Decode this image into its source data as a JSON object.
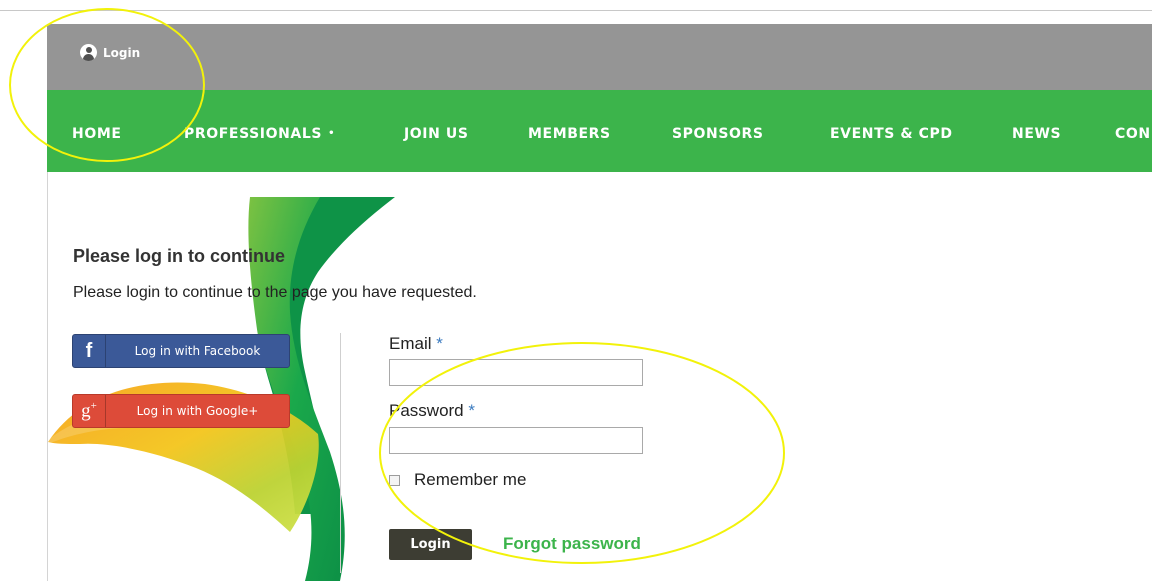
{
  "utility_bar": {
    "login_label": "Login",
    "icon": "user-icon"
  },
  "nav": {
    "items": [
      {
        "label": "HOME"
      },
      {
        "label": "PROFESSIONALS",
        "caret": "•"
      },
      {
        "label": "JOIN US"
      },
      {
        "label": "MEMBERS"
      },
      {
        "label": "SPONSORS"
      },
      {
        "label": "EVENTS & CPD"
      },
      {
        "label": "NEWS"
      },
      {
        "label": "CON"
      }
    ]
  },
  "page": {
    "title": "Please log in to continue",
    "subtitle": "Please login to continue to the page you have requested."
  },
  "social": {
    "facebook": {
      "icon_glyph": "f",
      "label": "Log in with Facebook"
    },
    "google": {
      "icon_glyph": "g",
      "icon_sup": "+",
      "label": "Log in with Google+"
    }
  },
  "form": {
    "email_label": "Email",
    "password_label": "Password",
    "required_mark": "*",
    "email_value": "",
    "password_value": "",
    "remember_label": "Remember me",
    "remember_checked": false,
    "submit_label": "Login",
    "forgot_label": "Forgot password"
  },
  "colors": {
    "utility_bar": "#959595",
    "nav_bg": "#3cb44b",
    "facebook": "#3b5998",
    "google": "#dd4b39",
    "submit_bg": "#3d3d33",
    "link_green": "#3cb44b",
    "annotation_yellow": "#f2f20a"
  }
}
